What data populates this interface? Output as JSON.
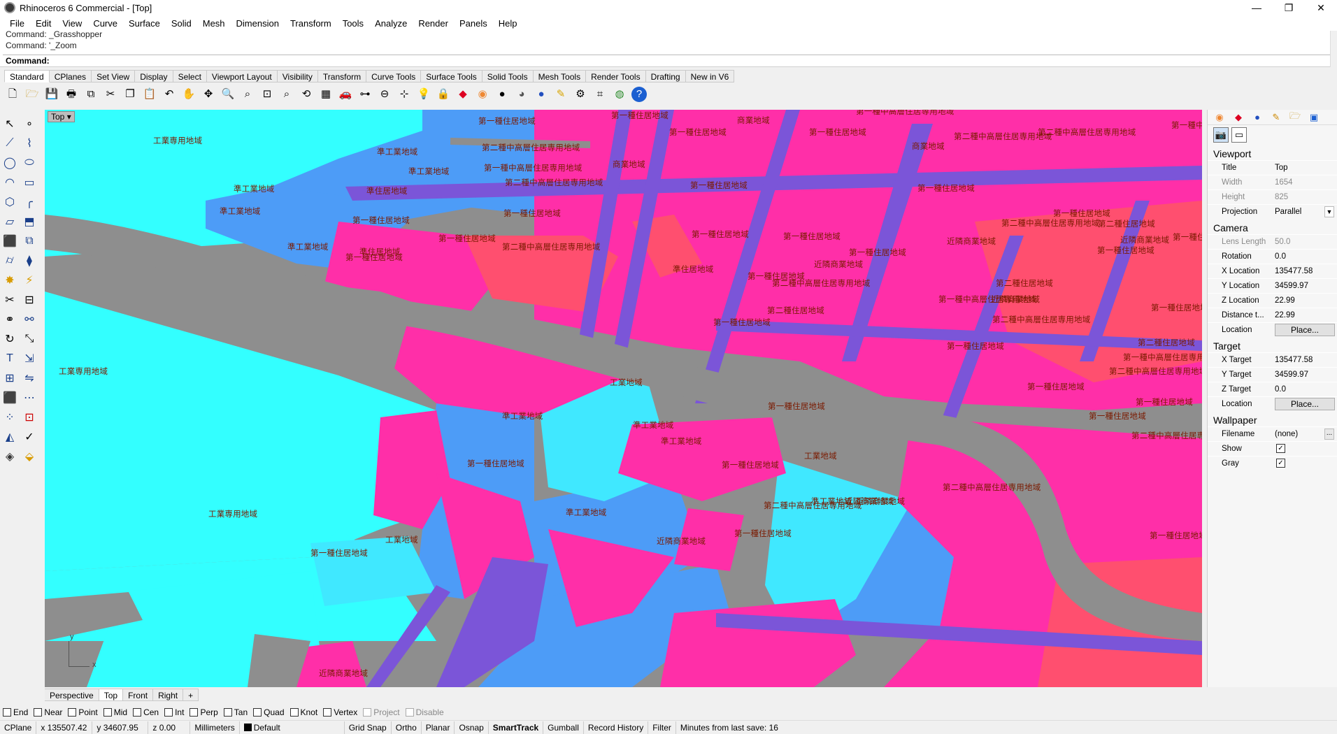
{
  "window": {
    "title": "Rhinoceros 6 Commercial - [Top]",
    "controls": [
      "—",
      "❐",
      "✕"
    ]
  },
  "menu": [
    "File",
    "Edit",
    "View",
    "Curve",
    "Surface",
    "Solid",
    "Mesh",
    "Dimension",
    "Transform",
    "Tools",
    "Analyze",
    "Render",
    "Panels",
    "Help"
  ],
  "command": {
    "history": [
      "Command: _Grasshopper",
      "Command: '_Zoom"
    ],
    "prompt": "Command:"
  },
  "toolbar_tabs": [
    "Standard",
    "CPlanes",
    "Set View",
    "Display",
    "Select",
    "Viewport Layout",
    "Visibility",
    "Transform",
    "Curve Tools",
    "Surface Tools",
    "Solid Tools",
    "Mesh Tools",
    "Render Tools",
    "Drafting",
    "New in V6"
  ],
  "toolbar_icons": [
    "new-icon",
    "open-icon",
    "save-icon",
    "print-icon",
    "import-icon",
    "copy-icon",
    "paste-icon",
    "undo-icon",
    "pan-icon",
    "move-icon",
    "zoom-icon",
    "zoom-window-icon",
    "zoom-extents-icon",
    "zoom-selected-icon",
    "rotate-view-icon",
    "grid-icon",
    "car-icon",
    "named-view-icon",
    "cplane-icon",
    "snap-icon",
    "light-icon",
    "lock-icon",
    "layer-icon",
    "color-wheel-icon",
    "shade-icon",
    "render-icon",
    "sphere-icon",
    "options-icon",
    "gear-icon",
    "macro-icon",
    "globe-icon",
    "help-icon"
  ],
  "viewport": {
    "title": "Top",
    "labels": [
      {
        "text": "工業専用地域"
      },
      {
        "text": "準工業地域"
      },
      {
        "text": "準工業地域"
      },
      {
        "text": "準工業地域"
      },
      {
        "text": "準工業地域"
      },
      {
        "text": "準工業地域"
      },
      {
        "text": "準住居地域"
      },
      {
        "text": "第一種住居地域"
      },
      {
        "text": "準住居地域"
      },
      {
        "text": "第一種住居地域"
      },
      {
        "text": "第一種住居地域"
      },
      {
        "text": "第二種中高層住居専用地域"
      },
      {
        "text": "第一種中高層住居専用地域"
      },
      {
        "text": "第二種中高層住居専用地域"
      },
      {
        "text": "商業地域"
      },
      {
        "text": "第一種住居地域"
      },
      {
        "text": "第一種住居地域"
      },
      {
        "text": "商業地域"
      },
      {
        "text": "第一種住居地域"
      },
      {
        "text": "第一種中高層住居専用地域"
      },
      {
        "text": "第二種中高層住居専用地域"
      },
      {
        "text": "第二種中高層住居専用地域"
      },
      {
        "text": "第一種住居地域"
      },
      {
        "text": "第一種住居地域"
      },
      {
        "text": "第一種住居地域"
      },
      {
        "text": "第二種中高層住居専用地域"
      },
      {
        "text": "第一種住居地域"
      },
      {
        "text": "第一種住居地域"
      },
      {
        "text": "近隣商業地域"
      },
      {
        "text": "第一種住居地域"
      },
      {
        "text": "第一種住居地域"
      },
      {
        "text": "第二種中高層住居専用地域"
      },
      {
        "text": "第二種住居地域"
      },
      {
        "text": "近隣商業地域"
      },
      {
        "text": "第一種住居地域"
      },
      {
        "text": "第二種住居地域"
      },
      {
        "text": "第一種住居地域"
      },
      {
        "text": "準住居地域"
      },
      {
        "text": "第一種住居地域"
      },
      {
        "text": "第二種中高層住居専用地域"
      },
      {
        "text": "第一種中高層住居専用地域"
      },
      {
        "text": "近隣商業地域"
      },
      {
        "text": "近隣商業地域"
      },
      {
        "text": "第二種中高層住居専用地域"
      },
      {
        "text": "第一種住居地域"
      },
      {
        "text": "第二種住居地域"
      },
      {
        "text": "第一種住居地域"
      },
      {
        "text": "工業専用地域"
      },
      {
        "text": "工業地域"
      },
      {
        "text": "第一種住居地域"
      },
      {
        "text": "準工業地域"
      },
      {
        "text": "準工業地域"
      },
      {
        "text": "準工業地域"
      },
      {
        "text": "第一種住居地域"
      },
      {
        "text": "工業地域"
      },
      {
        "text": "第一種住居地域"
      },
      {
        "text": "近隣商業地域"
      },
      {
        "text": "準工業地域"
      },
      {
        "text": "近隣商業地域"
      },
      {
        "text": "第二種中高層住居専用地域"
      },
      {
        "text": "準工業地域"
      },
      {
        "text": "工業専用地域"
      },
      {
        "text": "工業地域"
      },
      {
        "text": "第一種住居地域"
      },
      {
        "text": "近隣商業地域"
      },
      {
        "text": "第一種住居地域"
      },
      {
        "text": "第二種中高層住居専用地域"
      },
      {
        "text": "第一種住居地域"
      },
      {
        "text": "第一種住居地域"
      },
      {
        "text": "第二種中高層住居専用地域"
      },
      {
        "text": "第一種住居地域"
      },
      {
        "text": "第一種住居地域"
      },
      {
        "text": "第一種中高層住居専用地域"
      },
      {
        "text": "第二種中高層住居専用地域"
      },
      {
        "text": "第一種中高"
      },
      {
        "text": "商業地域"
      },
      {
        "text": "第一種住居地域"
      },
      {
        "text": "第二種住居地域"
      },
      {
        "text": "第一種住居地域"
      }
    ],
    "axis": {
      "x": "x",
      "y": "y"
    }
  },
  "viewport_tabs": [
    "Perspective",
    "Top",
    "Front",
    "Right",
    "+"
  ],
  "panel": {
    "tab_icons": [
      "color-icon",
      "layer-icon",
      "material-icon",
      "render-icon",
      "folder-icon",
      "display-icon"
    ],
    "sub_icons": [
      "camera-icon",
      "viewport-icon"
    ],
    "viewport_section": "Viewport",
    "viewport_rows": [
      {
        "k": "Title",
        "v": "Top"
      },
      {
        "k": "Width",
        "v": "1654"
      },
      {
        "k": "Height",
        "v": "825"
      },
      {
        "k": "Projection",
        "v": "Parallel"
      }
    ],
    "camera_section": "Camera",
    "camera_rows": [
      {
        "k": "Lens Length",
        "v": "50.0"
      },
      {
        "k": "Rotation",
        "v": "0.0"
      },
      {
        "k": "X Location",
        "v": "135477.58"
      },
      {
        "k": "Y Location",
        "v": "34599.97"
      },
      {
        "k": "Z Location",
        "v": "22.99"
      },
      {
        "k": "Distance t...",
        "v": "22.99"
      },
      {
        "k": "Location",
        "v": "Place..."
      }
    ],
    "target_section": "Target",
    "target_rows": [
      {
        "k": "X Target",
        "v": "135477.58"
      },
      {
        "k": "Y Target",
        "v": "34599.97"
      },
      {
        "k": "Z Target",
        "v": "0.0"
      },
      {
        "k": "Location",
        "v": "Place..."
      }
    ],
    "wallpaper_section": "Wallpaper",
    "wallpaper_rows": [
      {
        "k": "Filename",
        "v": "(none)"
      },
      {
        "k": "Show",
        "v": "✓"
      },
      {
        "k": "Gray",
        "v": "✓"
      }
    ]
  },
  "osnaps": [
    {
      "label": "End",
      "enabled": true
    },
    {
      "label": "Near",
      "enabled": true
    },
    {
      "label": "Point",
      "enabled": true
    },
    {
      "label": "Mid",
      "enabled": true
    },
    {
      "label": "Cen",
      "enabled": true
    },
    {
      "label": "Int",
      "enabled": true
    },
    {
      "label": "Perp",
      "enabled": true
    },
    {
      "label": "Tan",
      "enabled": true
    },
    {
      "label": "Quad",
      "enabled": true
    },
    {
      "label": "Knot",
      "enabled": true
    },
    {
      "label": "Vertex",
      "enabled": true
    },
    {
      "label": "Project",
      "enabled": false
    },
    {
      "label": "Disable",
      "enabled": false
    }
  ],
  "status": {
    "cplane": "CPlane",
    "x": "x 135507.42",
    "y": "y 34607.95",
    "z": "z 0.00",
    "units": "Millimeters",
    "layer": "Default",
    "toggles": [
      "Grid Snap",
      "Ortho",
      "Planar",
      "Osnap",
      "SmartTrack",
      "Gumball",
      "Record History",
      "Filter"
    ],
    "message": "Minutes from last save: 16"
  },
  "colors": {
    "industrial": "#33ffff",
    "semi_industrial": "#4d9cf7",
    "residential": "#ff2fa8",
    "highway": "#8e8e8e",
    "road": "#7b55d8",
    "commercial": "#ff4f6f",
    "text": "#7a1a00"
  }
}
